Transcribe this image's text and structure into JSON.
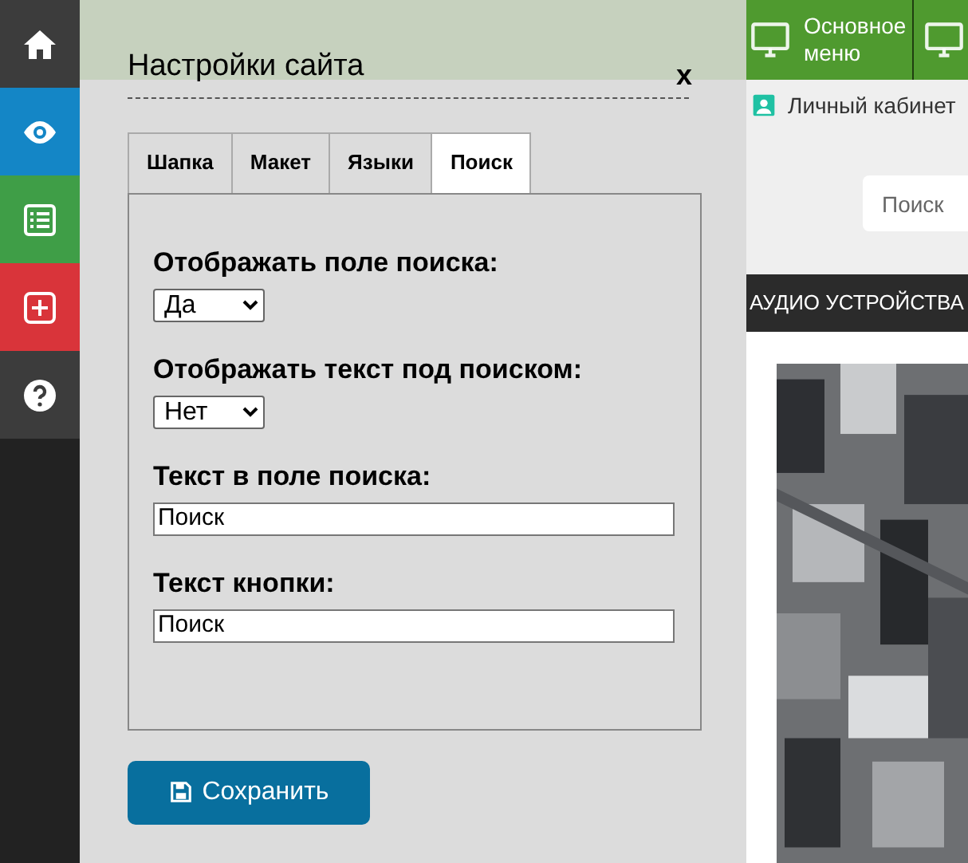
{
  "sidebar": {
    "items": [
      {
        "kind": "home",
        "color": "#3c3c3c"
      },
      {
        "kind": "eye",
        "color": "#1486c6"
      },
      {
        "kind": "list",
        "color": "#3f9e47"
      },
      {
        "kind": "plus",
        "color": "#d9343a"
      },
      {
        "kind": "help",
        "color": "#3c3c3c"
      }
    ]
  },
  "dialog": {
    "title": "Настройки сайта",
    "close": "x",
    "tabs": [
      {
        "label": "Шапка",
        "selected": false
      },
      {
        "label": "Макет",
        "selected": false
      },
      {
        "label": "Языки",
        "selected": false
      },
      {
        "label": "Поиск",
        "selected": true
      }
    ],
    "fields": [
      {
        "kind": "select",
        "label": "Отображать поле поиска:",
        "value": "Да"
      },
      {
        "kind": "select",
        "label": "Отображать текст под поиском:",
        "value": "Нет"
      },
      {
        "kind": "text",
        "label": "Текст в поле поиска:",
        "value": "Поиск"
      },
      {
        "kind": "text",
        "label": "Текст кнопки:",
        "value": "Поиск"
      }
    ],
    "save_button": "Сохранить"
  },
  "toolbar": {
    "items": [
      {
        "kind": "monitor",
        "lines": [
          "Основное",
          "меню"
        ]
      },
      {
        "kind": "monitor"
      }
    ]
  },
  "nav_links": [
    {
      "kind": "user",
      "label": "Личный кабинет"
    }
  ],
  "search_field": {
    "placeholder": "Поиск"
  },
  "category_banner": "АУДИО УСТРОЙСТВА"
}
